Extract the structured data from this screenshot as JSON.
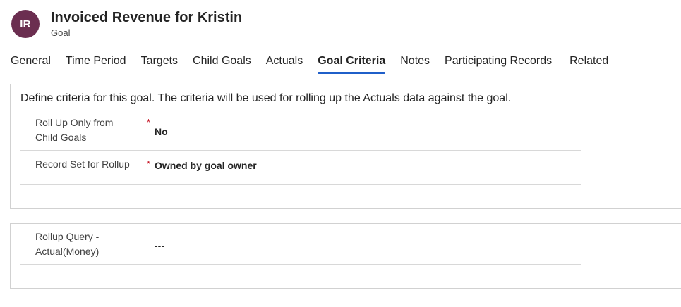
{
  "header": {
    "avatar_initials": "IR",
    "avatar_color": "#6b2e50",
    "title": "Invoiced Revenue for Kristin",
    "entity": "Goal"
  },
  "tabs": [
    {
      "label": "General",
      "active": false
    },
    {
      "label": "Time Period",
      "active": false
    },
    {
      "label": "Targets",
      "active": false
    },
    {
      "label": "Child Goals",
      "active": false
    },
    {
      "label": "Actuals",
      "active": false
    },
    {
      "label": "Goal Criteria",
      "active": true
    },
    {
      "label": "Notes",
      "active": false
    },
    {
      "label": "Participating Records",
      "active": false
    },
    {
      "label": "Related",
      "active": false
    }
  ],
  "accent_color": "#1f5fc9",
  "criteria_section": {
    "description": "Define criteria for this goal. The criteria will be used for rolling up the Actuals data against the goal.",
    "fields": [
      {
        "label": "Roll Up Only from Child Goals",
        "required": "*",
        "value": "No"
      },
      {
        "label": "Record Set for Rollup",
        "required": "*",
        "value": "Owned by goal owner"
      }
    ]
  },
  "rollup_section": {
    "fields": [
      {
        "label": "Rollup Query - Actual(Money)",
        "value": "---"
      }
    ]
  }
}
